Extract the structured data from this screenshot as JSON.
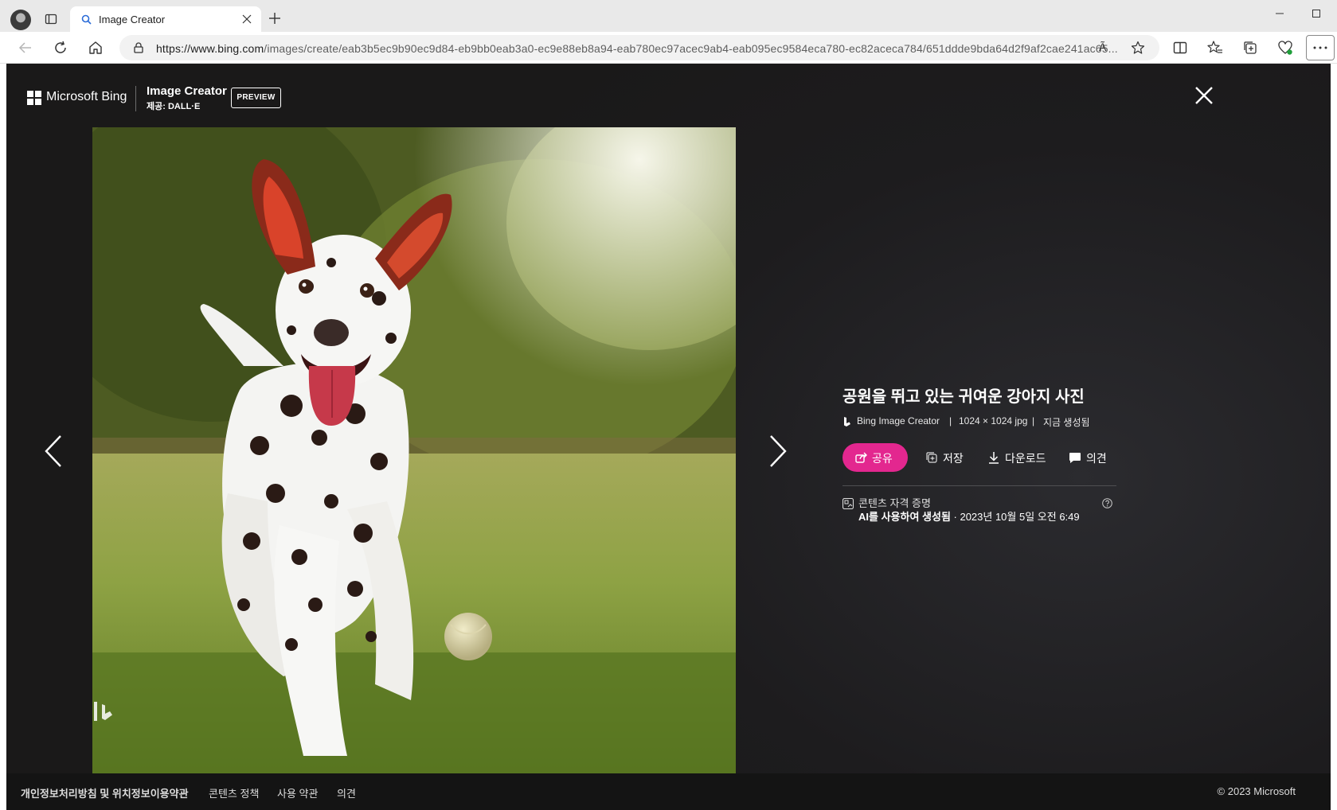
{
  "browser": {
    "tab_title": "Image Creator",
    "url_host": "https://www.bing.com",
    "url_path": "/images/create/eab3b5ec9b90ec9d84-eb9bb0eab3a0-ec9e88eb8a94-eab780ec97acec9ab4-eab095ec9584eca780-ec82aceca784/651ddde9bda64d2f9af2cae241ac65...",
    "read_aloud_glyph": "A͂"
  },
  "header": {
    "brand_name": "Microsoft Bing",
    "product_title": "Image Creator",
    "product_subtitle": "제공: DALL·E",
    "preview_label": "PREVIEW"
  },
  "image": {
    "watermark_icon": "bing-b-icon"
  },
  "details": {
    "title": "공원을 뛰고 있는 귀여운 강아지 사진",
    "source": "Bing Image Creator",
    "dimensions": "1024 × 1024 jpg",
    "status": "지금 생성됨",
    "separator": "|",
    "actions": {
      "share": "공유",
      "save": "저장",
      "download": "다운로드",
      "feedback": "의견"
    },
    "credentials": {
      "title": "콘텐츠 자격 증명",
      "generated_by": "AI를 사용하여 생성됨",
      "timestamp": " · 2023년 10월 5일 오전 6:49"
    }
  },
  "footer": {
    "links": [
      "개인정보처리방침 및 위치정보이용약관",
      "콘텐츠 정책",
      "사용 약관",
      "의견"
    ],
    "copyright": "© 2023 Microsoft"
  },
  "colors": {
    "accent": "#e3278f",
    "page_background": "#1b1a1b",
    "footer_background": "#141414"
  }
}
